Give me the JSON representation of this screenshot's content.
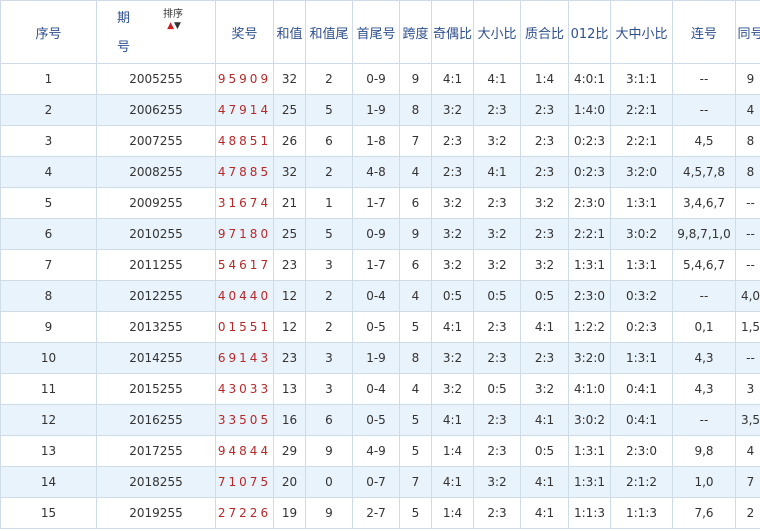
{
  "header": {
    "seq": "序号",
    "period_line1": "期",
    "period_line2": "号",
    "sort_label": "排序",
    "sort_up": "▲",
    "sort_down": "▼",
    "prize": "奖号",
    "sum": "和值",
    "sum_tail": "和值尾",
    "first_last": "首尾号",
    "span": "跨度",
    "odd_even": "奇偶比",
    "big_small": "大小比",
    "prime_composite": "质合比",
    "ratio_012": "012比",
    "big_mid_small": "大中小比",
    "consecutive": "连号",
    "same": "同号"
  },
  "rows": [
    {
      "seq": "1",
      "period": "2005255",
      "prize": "95909",
      "sum": "32",
      "sum_tail": "2",
      "first_last": "0-9",
      "span": "9",
      "odd_even": "4:1",
      "big_small": "4:1",
      "prime_composite": "1:4",
      "ratio_012": "4:0:1",
      "big_mid_small": "3:1:1",
      "consecutive": "--",
      "same": "9"
    },
    {
      "seq": "2",
      "period": "2006255",
      "prize": "47914",
      "sum": "25",
      "sum_tail": "5",
      "first_last": "1-9",
      "span": "8",
      "odd_even": "3:2",
      "big_small": "2:3",
      "prime_composite": "2:3",
      "ratio_012": "1:4:0",
      "big_mid_small": "2:2:1",
      "consecutive": "--",
      "same": "4"
    },
    {
      "seq": "3",
      "period": "2007255",
      "prize": "48851",
      "sum": "26",
      "sum_tail": "6",
      "first_last": "1-8",
      "span": "7",
      "odd_even": "2:3",
      "big_small": "3:2",
      "prime_composite": "2:3",
      "ratio_012": "0:2:3",
      "big_mid_small": "2:2:1",
      "consecutive": "4,5",
      "same": "8"
    },
    {
      "seq": "4",
      "period": "2008255",
      "prize": "47885",
      "sum": "32",
      "sum_tail": "2",
      "first_last": "4-8",
      "span": "4",
      "odd_even": "2:3",
      "big_small": "4:1",
      "prime_composite": "2:3",
      "ratio_012": "0:2:3",
      "big_mid_small": "3:2:0",
      "consecutive": "4,5,7,8",
      "same": "8"
    },
    {
      "seq": "5",
      "period": "2009255",
      "prize": "31674",
      "sum": "21",
      "sum_tail": "1",
      "first_last": "1-7",
      "span": "6",
      "odd_even": "3:2",
      "big_small": "2:3",
      "prime_composite": "3:2",
      "ratio_012": "2:3:0",
      "big_mid_small": "1:3:1",
      "consecutive": "3,4,6,7",
      "same": "--"
    },
    {
      "seq": "6",
      "period": "2010255",
      "prize": "97180",
      "sum": "25",
      "sum_tail": "5",
      "first_last": "0-9",
      "span": "9",
      "odd_even": "3:2",
      "big_small": "3:2",
      "prime_composite": "2:3",
      "ratio_012": "2:2:1",
      "big_mid_small": "3:0:2",
      "consecutive": "9,8,7,1,0",
      "same": "--"
    },
    {
      "seq": "7",
      "period": "2011255",
      "prize": "54617",
      "sum": "23",
      "sum_tail": "3",
      "first_last": "1-7",
      "span": "6",
      "odd_even": "3:2",
      "big_small": "3:2",
      "prime_composite": "3:2",
      "ratio_012": "1:3:1",
      "big_mid_small": "1:3:1",
      "consecutive": "5,4,6,7",
      "same": "--"
    },
    {
      "seq": "8",
      "period": "2012255",
      "prize": "40440",
      "sum": "12",
      "sum_tail": "2",
      "first_last": "0-4",
      "span": "4",
      "odd_even": "0:5",
      "big_small": "0:5",
      "prime_composite": "0:5",
      "ratio_012": "2:3:0",
      "big_mid_small": "0:3:2",
      "consecutive": "--",
      "same": "4,0"
    },
    {
      "seq": "9",
      "period": "2013255",
      "prize": "01551",
      "sum": "12",
      "sum_tail": "2",
      "first_last": "0-5",
      "span": "5",
      "odd_even": "4:1",
      "big_small": "2:3",
      "prime_composite": "4:1",
      "ratio_012": "1:2:2",
      "big_mid_small": "0:2:3",
      "consecutive": "0,1",
      "same": "1,5"
    },
    {
      "seq": "10",
      "period": "2014255",
      "prize": "69143",
      "sum": "23",
      "sum_tail": "3",
      "first_last": "1-9",
      "span": "8",
      "odd_even": "3:2",
      "big_small": "2:3",
      "prime_composite": "2:3",
      "ratio_012": "3:2:0",
      "big_mid_small": "1:3:1",
      "consecutive": "4,3",
      "same": "--"
    },
    {
      "seq": "11",
      "period": "2015255",
      "prize": "43033",
      "sum": "13",
      "sum_tail": "3",
      "first_last": "0-4",
      "span": "4",
      "odd_even": "3:2",
      "big_small": "0:5",
      "prime_composite": "3:2",
      "ratio_012": "4:1:0",
      "big_mid_small": "0:4:1",
      "consecutive": "4,3",
      "same": "3"
    },
    {
      "seq": "12",
      "period": "2016255",
      "prize": "33505",
      "sum": "16",
      "sum_tail": "6",
      "first_last": "0-5",
      "span": "5",
      "odd_even": "4:1",
      "big_small": "2:3",
      "prime_composite": "4:1",
      "ratio_012": "3:0:2",
      "big_mid_small": "0:4:1",
      "consecutive": "--",
      "same": "3,5"
    },
    {
      "seq": "13",
      "period": "2017255",
      "prize": "94844",
      "sum": "29",
      "sum_tail": "9",
      "first_last": "4-9",
      "span": "5",
      "odd_even": "1:4",
      "big_small": "2:3",
      "prime_composite": "0:5",
      "ratio_012": "1:3:1",
      "big_mid_small": "2:3:0",
      "consecutive": "9,8",
      "same": "4"
    },
    {
      "seq": "14",
      "period": "2018255",
      "prize": "71075",
      "sum": "20",
      "sum_tail": "0",
      "first_last": "0-7",
      "span": "7",
      "odd_even": "4:1",
      "big_small": "3:2",
      "prime_composite": "4:1",
      "ratio_012": "1:3:1",
      "big_mid_small": "2:1:2",
      "consecutive": "1,0",
      "same": "7"
    },
    {
      "seq": "15",
      "period": "2019255",
      "prize": "27226",
      "sum": "19",
      "sum_tail": "9",
      "first_last": "2-7",
      "span": "5",
      "odd_even": "1:4",
      "big_small": "2:3",
      "prime_composite": "4:1",
      "ratio_012": "1:1:3",
      "big_mid_small": "1:1:3",
      "consecutive": "7,6",
      "same": "2"
    }
  ]
}
